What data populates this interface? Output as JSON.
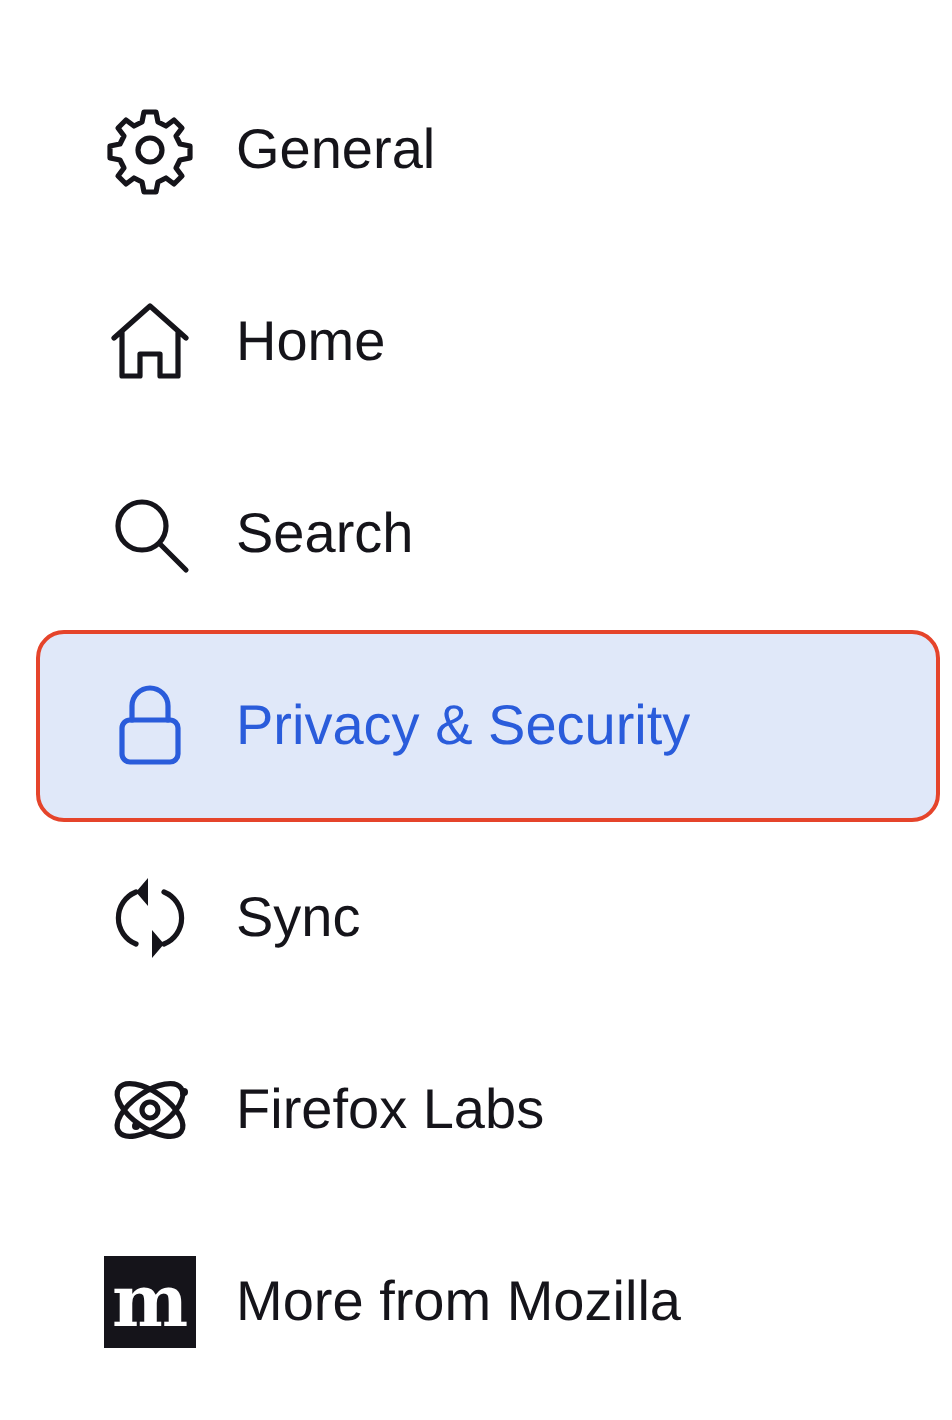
{
  "sidebar": {
    "items": [
      {
        "kind": "gear",
        "label": "General",
        "selected": false
      },
      {
        "kind": "home",
        "label": "Home",
        "selected": false
      },
      {
        "kind": "search",
        "label": "Search",
        "selected": false
      },
      {
        "kind": "lock",
        "label": "Privacy & Security",
        "selected": true
      },
      {
        "kind": "sync",
        "label": "Sync",
        "selected": false
      },
      {
        "kind": "atom",
        "label": "Firefox Labs",
        "selected": false
      },
      {
        "kind": "logo",
        "label": "More from Mozilla",
        "selected": false,
        "logo_text": "m"
      }
    ]
  }
}
